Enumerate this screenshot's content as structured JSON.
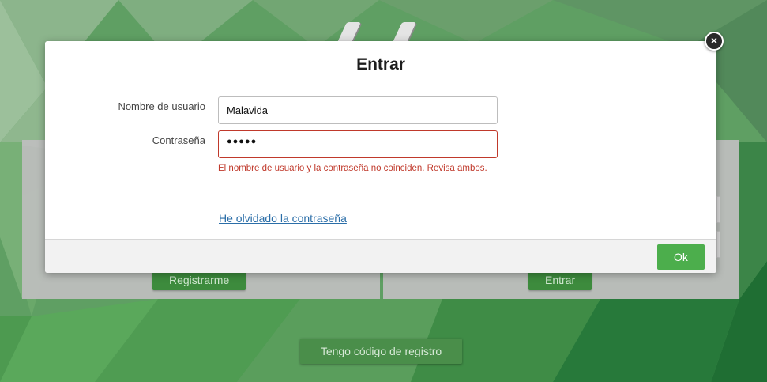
{
  "background": {
    "register_button_label": "Registrarme",
    "login_button_label": "Entrar",
    "registration_code_button_label": "Tengo código de registro"
  },
  "modal": {
    "title": "Entrar",
    "username_label": "Nombre de usuario",
    "username_value": "Malavida",
    "password_label": "Contraseña",
    "password_mask": "●●●●●",
    "error_message": "El nombre de usuario y la contraseña no coinciden. Revisa ambos.",
    "forgot_password_link": "He olvidado la contraseña",
    "ok_button_label": "Ok",
    "close_icon": "close-icon"
  },
  "colors": {
    "accent_green": "#4cae4c",
    "error_red": "#c0392b",
    "link_blue": "#2b6ea8"
  }
}
